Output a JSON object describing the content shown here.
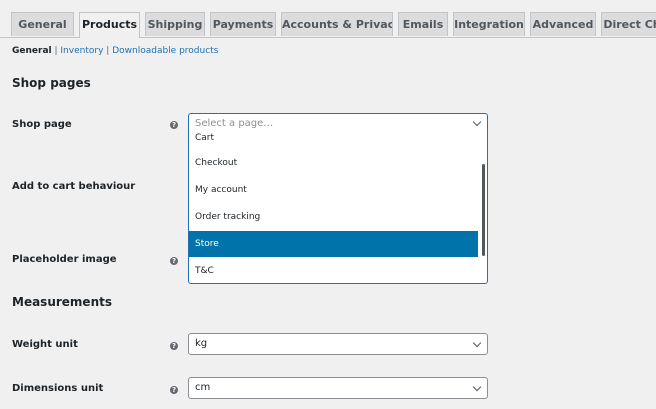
{
  "tabs": [
    "General",
    "Products",
    "Shipping",
    "Payments",
    "Accounts & Privacy",
    "Emails",
    "Integration",
    "Advanced",
    "Direct Ch"
  ],
  "active_tab": "Products",
  "subnav": {
    "current": "General",
    "sep": "|",
    "links": [
      "Inventory",
      "Downloadable products"
    ]
  },
  "section_shop_pages": "Shop pages",
  "section_measurements": "Measurements",
  "fields": {
    "shop_page": "Shop page",
    "add_to_cart": "Add to cart behaviour",
    "placeholder_image": "Placeholder image",
    "weight_unit": "Weight unit",
    "dimensions_unit": "Dimensions unit"
  },
  "help_glyph": "?",
  "dropdown": {
    "search_placeholder": "Select a page…",
    "options": [
      "Cart",
      "Checkout",
      "My account",
      "Order tracking",
      "Store",
      "T&C"
    ],
    "highlighted": "Store"
  },
  "weight_value": "kg",
  "dimensions_value": "cm"
}
